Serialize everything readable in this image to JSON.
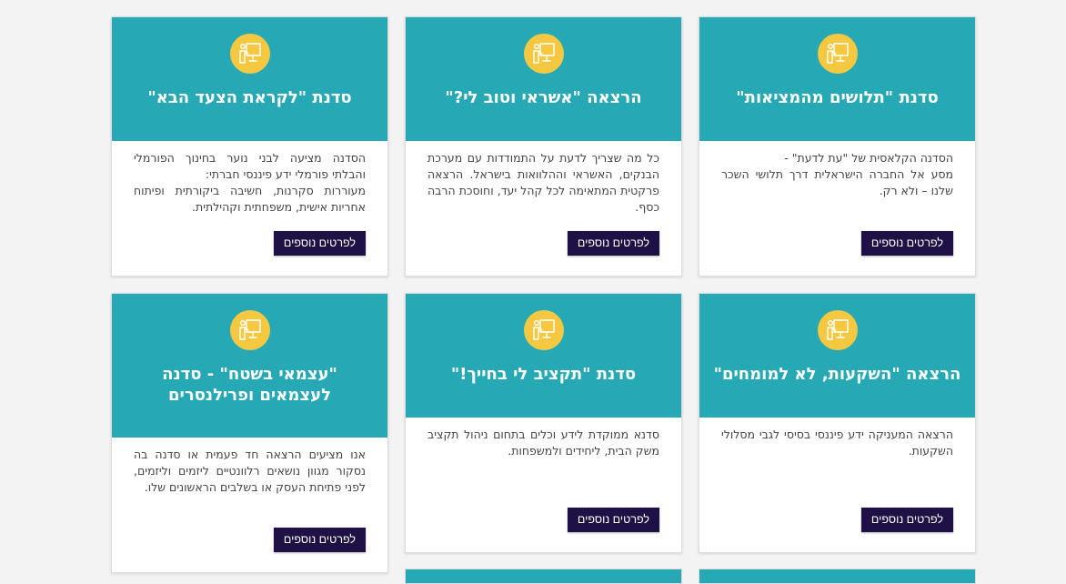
{
  "theme": {
    "card_header_color": "#26a9b5",
    "icon_circle_color": "#f5c842",
    "button_color": "#1f1145",
    "page_background": "#f3f3f3"
  },
  "icon": "teacher-presentation-icon",
  "cards": [
    {
      "title": "סדנת \"לקראת הצעד הבא\"",
      "description": "הסדנה מציעה לבני נוער בחינוך הפורמלי והבלתי פורמלי ידע פיננסי חברתי:\nמעוררות סקרנות, חשיבה ביקורתית ופיתוח אחריות אישית, משפחתית וקהילתית.",
      "button": "לפרטים נוספים"
    },
    {
      "title": "הרצאה \"אשראי וטוב לי?\"",
      "description": "כל מה שצריך לדעת על התמודדות עם מערכת הבנקים, האשראי וההלוואות בישראל. הרצאה פרקטית המתאימה לכל קהל יעד, וחוסכת הרבה כסף.",
      "button": "לפרטים נוספים"
    },
    {
      "title": "סדנת \"תלושים מהמציאות\"",
      "description": "הסדנה הקלאסית של \"עת לדעת\" -\nמסע אל החברה הישראלית דרך תלושי השכר שלנו – ולא רק.",
      "button": "לפרטים נוספים"
    },
    {
      "title": "\"עצמאי בשטח\" - סדנה לעצמאים ופרילנסרים",
      "description": "אנו מציעים הרצאה חד פעמית או סדנה בה נסקור מגוון נושאים רלוונטיים ליזמים וליזמים, לפני פתיחת העסק או בשלבים הראשונים שלו.",
      "button": "לפרטים נוספים"
    },
    {
      "title": "סדנת \"תקציב לי בחייך!\"",
      "description": "סדנא ממוקדת לידע וכלים בתחום ניהול תקציב משק הבית, ליחידים ולמשפחות.",
      "button": "לפרטים נוספים"
    },
    {
      "title": "הרצאה \"השקעות, לא למומחים\"",
      "description": "הרצאה המעניקה ידע פיננסי בסיסי לגבי מסלולי השקעות.",
      "button": "לפרטים נוספים"
    }
  ]
}
